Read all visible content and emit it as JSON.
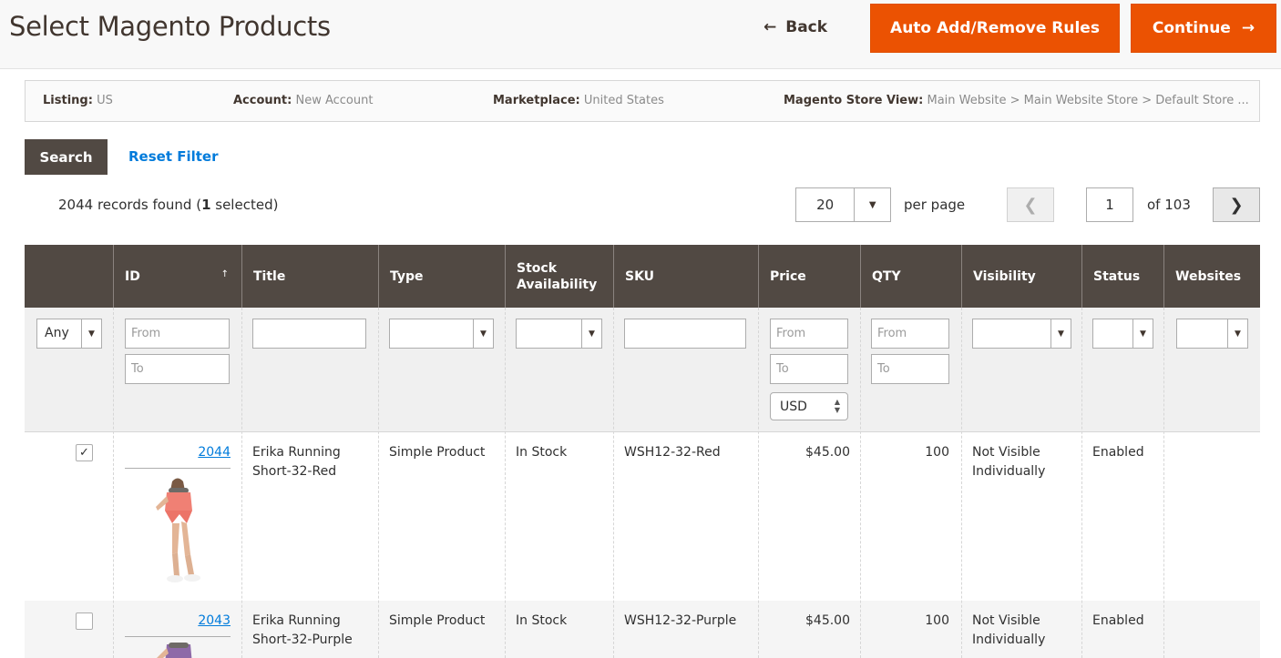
{
  "header": {
    "title": "Select Magento Products",
    "back_label": "Back",
    "rules_label": "Auto Add/Remove Rules",
    "continue_label": "Continue"
  },
  "info": {
    "listing_label": "Listing:",
    "listing_value": "US",
    "account_label": "Account:",
    "account_value": "New Account",
    "marketplace_label": "Marketplace:",
    "marketplace_value": "United States",
    "store_label": "Magento Store View:",
    "store_value": "Main Website > Main Website Store > Default Store ..."
  },
  "controls": {
    "search_label": "Search",
    "reset_label": "Reset Filter",
    "records_prefix": "2044 records found (",
    "selected_count": "1",
    "records_suffix": " selected)",
    "per_page_value": "20",
    "per_page_label": "per page",
    "page_value": "1",
    "of_label": "of 103"
  },
  "columns": {
    "id": "ID",
    "title": "Title",
    "type": "Type",
    "stock_line1": "Stock",
    "stock_line2": "Availability",
    "sku": "SKU",
    "price": "Price",
    "qty": "QTY",
    "visibility": "Visibility",
    "status": "Status",
    "websites": "Websites"
  },
  "filters": {
    "any_label": "Any",
    "from_placeholder": "From",
    "to_placeholder": "To",
    "currency": "USD"
  },
  "rows": [
    {
      "checked": true,
      "id": "2044",
      "title_line1": "Erika Running",
      "title_line2": "Short-32-Red",
      "type": "Simple Product",
      "stock": "In Stock",
      "sku": "WSH12-32-Red",
      "price": "$45.00",
      "qty": "100",
      "visibility_line1": "Not Visible",
      "visibility_line2": "Individually",
      "status": "Enabled",
      "websites": ""
    },
    {
      "checked": false,
      "id": "2043",
      "title_line1": "Erika Running",
      "title_line2": "Short-32-Purple",
      "type": "Simple Product",
      "stock": "In Stock",
      "sku": "WSH12-32-Purple",
      "price": "$45.00",
      "qty": "100",
      "visibility_line1": "Not Visible",
      "visibility_line2": "Individually",
      "status": "Enabled",
      "websites": ""
    }
  ],
  "icons": {
    "back": "arrow-left-icon",
    "continue": "arrow-right-icon",
    "prev": "chevron-left-icon",
    "next": "chevron-right-icon",
    "dropdown": "caret-down-icon",
    "check": "checkmark-icon"
  },
  "colors": {
    "accent": "#eb5202",
    "header_dark": "#514943",
    "link": "#007bdb"
  }
}
